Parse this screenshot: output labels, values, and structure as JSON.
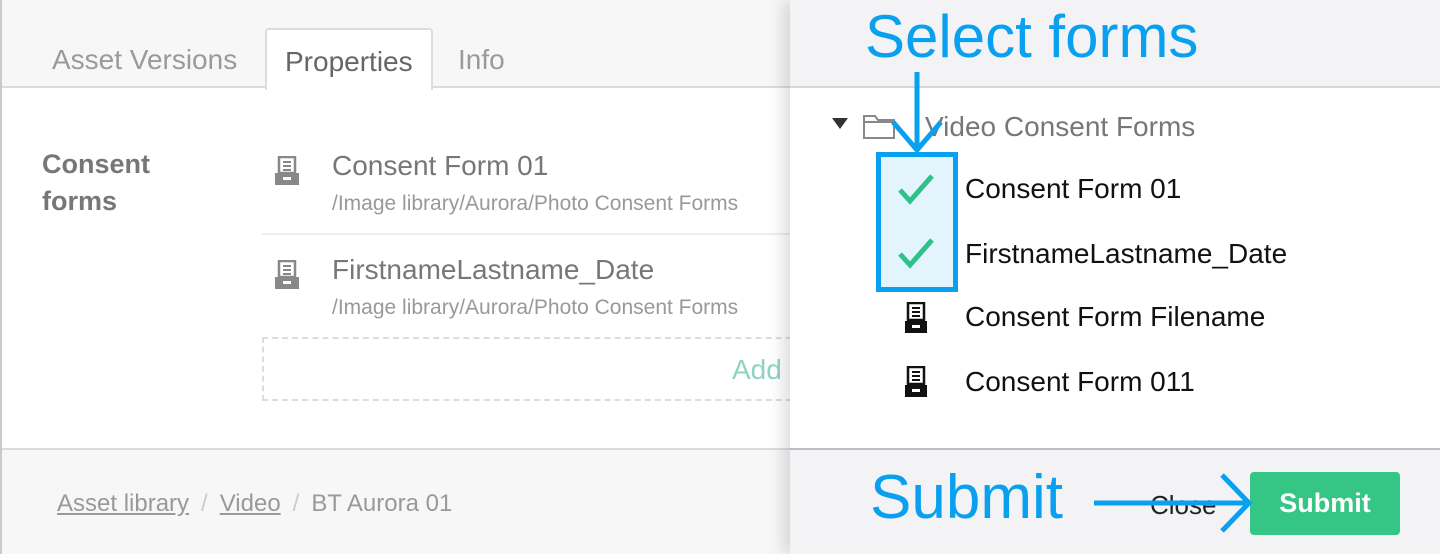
{
  "tabs": [
    {
      "label": "Asset Versions"
    },
    {
      "label": "Properties",
      "active": true
    },
    {
      "label": "Info"
    }
  ],
  "properties": {
    "field_label": "Consent forms",
    "items": [
      {
        "title": "Consent Form 01",
        "path": "/Image library/Aurora/Photo Consent Forms"
      },
      {
        "title": "FirstnameLastname_Date",
        "path": "/Image library/Aurora/Photo Consent Forms"
      }
    ],
    "add_label": "Add"
  },
  "breadcrumb": [
    {
      "label": "Asset library"
    },
    {
      "label": "Video"
    },
    {
      "label": "BT Aurora 01"
    }
  ],
  "picker": {
    "folder": "Video Consent Forms",
    "items": [
      {
        "label": "Consent Form 01",
        "selected": true
      },
      {
        "label": "FirstnameLastname_Date",
        "selected": true
      },
      {
        "label": "Consent Form Filename",
        "selected": false
      },
      {
        "label": "Consent Form 011",
        "selected": false
      }
    ],
    "close_label": "Close",
    "submit_label": "Submit"
  },
  "annotations": {
    "select": "Select forms",
    "submit": "Submit",
    "color": "#0aa0f0"
  },
  "colors": {
    "accent": "#35c585",
    "check": "#2cc28a"
  }
}
